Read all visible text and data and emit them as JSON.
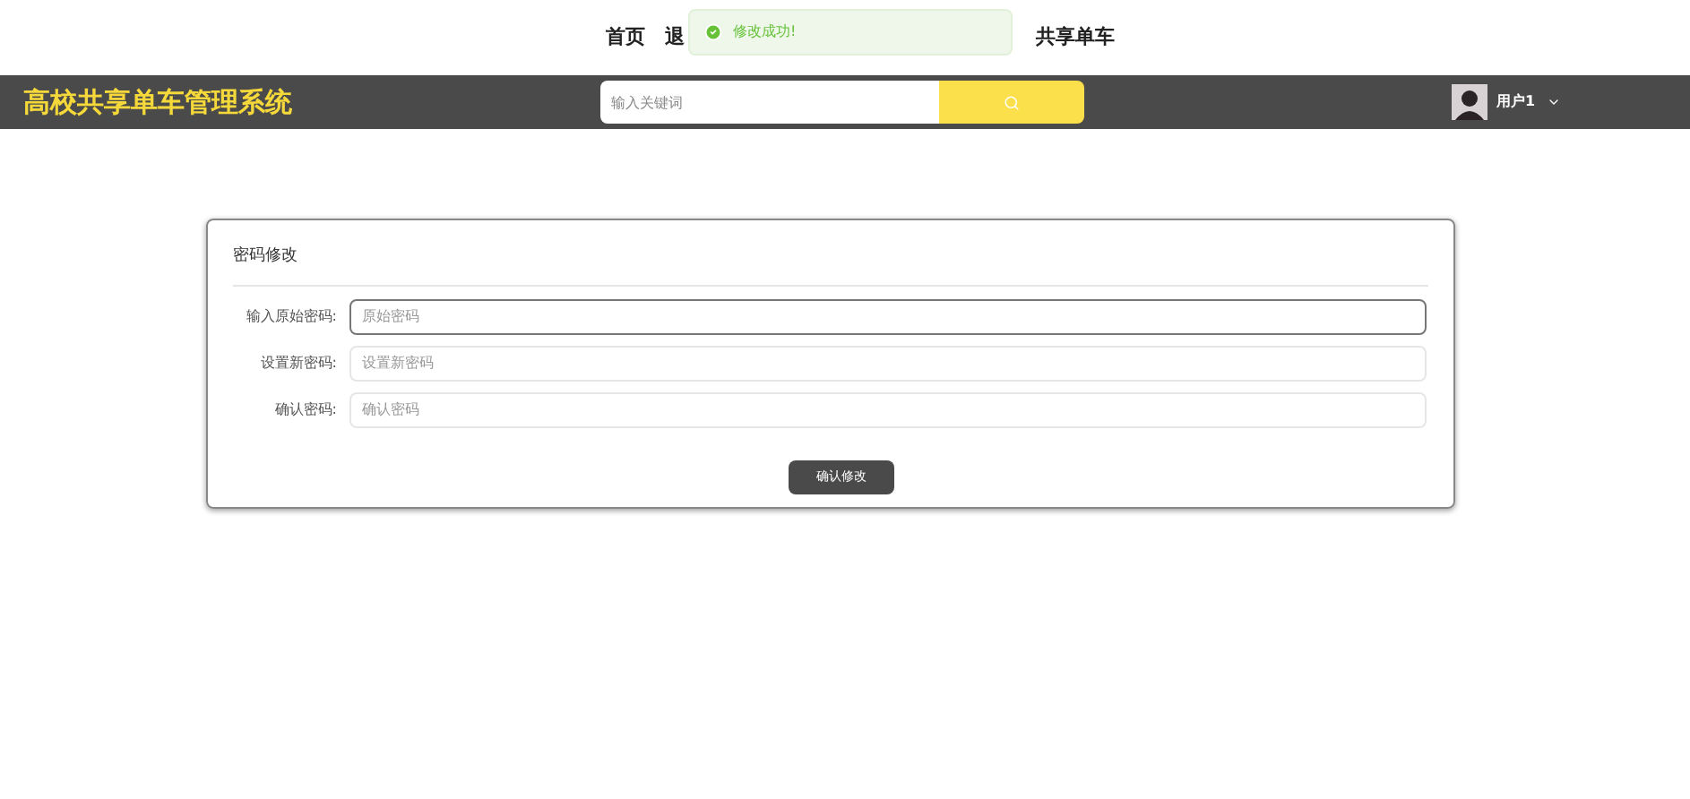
{
  "nav": [
    {
      "label": "首页"
    },
    {
      "label": "退"
    },
    {
      "label": "共享单车"
    }
  ],
  "toast": {
    "message": "修改成功!"
  },
  "header": {
    "title": "高校共享单车管理系统",
    "search": {
      "placeholder": "输入关键词"
    },
    "user": {
      "name": "用户1"
    }
  },
  "card": {
    "title": "密码修改",
    "fields": [
      {
        "label": "输入原始密码:",
        "placeholder": "原始密码",
        "focused": true
      },
      {
        "label": "设置新密码:",
        "placeholder": "设置新密码",
        "focused": false
      },
      {
        "label": "确认密码:",
        "placeholder": "确认密码",
        "focused": false
      }
    ],
    "submit": "确认修改"
  }
}
